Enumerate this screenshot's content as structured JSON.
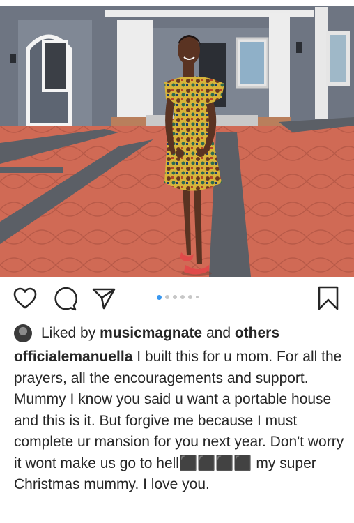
{
  "photo": {
    "alt": "Girl in patterned dress standing on driveway in front of a grey house"
  },
  "actions": {
    "like_icon": "heart-icon",
    "comment_icon": "comment-icon",
    "share_icon": "paper-plane-icon",
    "save_icon": "bookmark-icon",
    "carousel": {
      "total": 6,
      "active": 1
    }
  },
  "likes": {
    "prefix": "Liked by ",
    "user": "musicmagnate",
    "conjunction": " and ",
    "others": "others"
  },
  "caption": {
    "username": "officialemanuella",
    "text": " I built this for u mom. For all the prayers, all the encouragements and support. Mummy I know you said u want a portable house and this is it. But forgive me because I must complete ur mansion for you next year. Don't worry it wont make us go to hell⬛⬛⬛⬛ my super Christmas mummy. I love you."
  },
  "colors": {
    "accent_dot": "#3897f0",
    "inactive_dot": "#c7c7c7",
    "text": "#262626"
  }
}
